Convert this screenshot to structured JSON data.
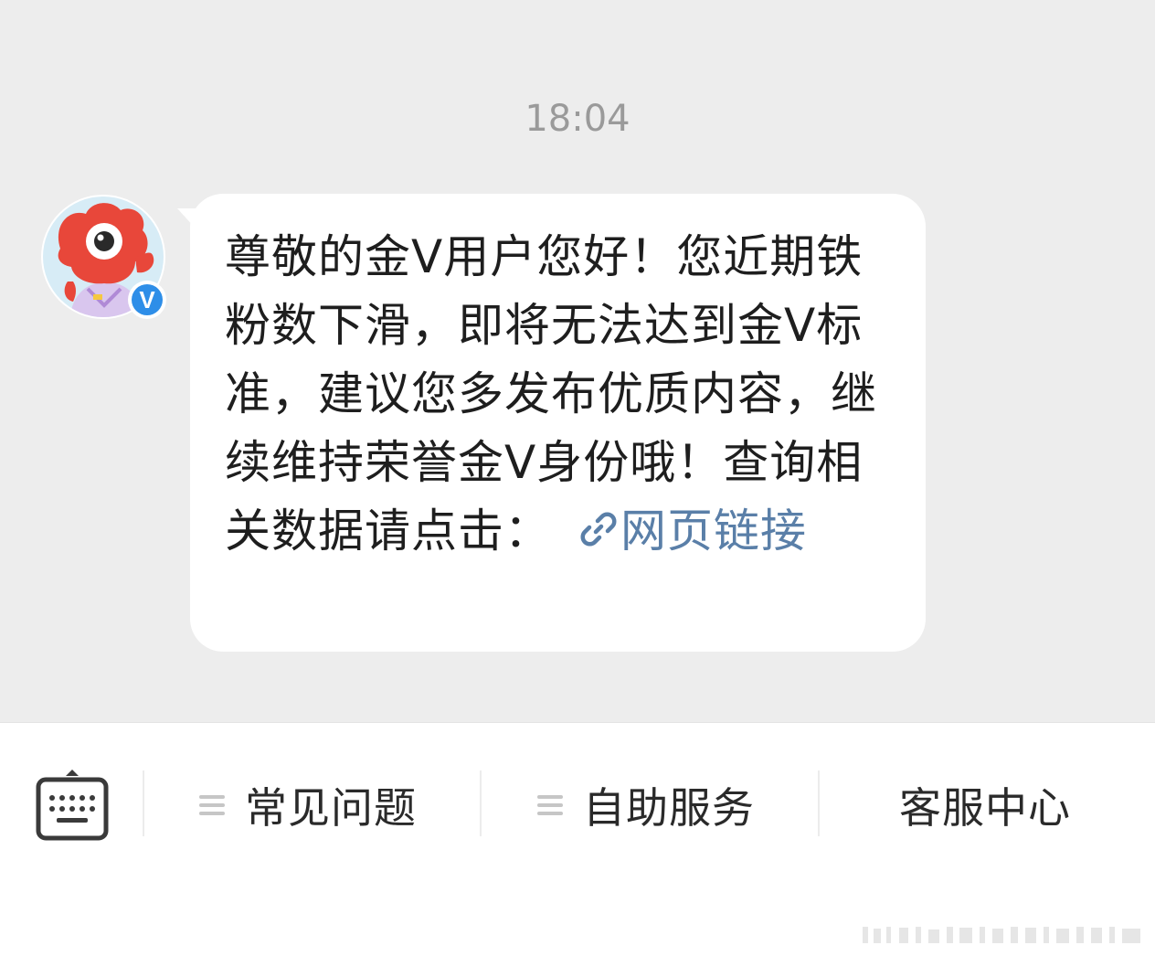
{
  "chat": {
    "timestamp": "18:04",
    "message": {
      "text": "尊敬的金V用户您好！您近期铁粉数下滑，即将无法达到金V标准，建议您多发布优质内容，继续维持荣誉金V身份哦！查询相关数据请点击：",
      "link_label": "网页链接",
      "link_icon": "link-icon"
    },
    "avatar": {
      "badge": "V",
      "badge_color": "#2e8ee8",
      "mascot_color": "#ea4a3a"
    }
  },
  "bottom_menu": {
    "keyboard_icon": "keyboard-icon",
    "items": [
      {
        "label": "常见问题",
        "icon": "menu-lines-icon"
      },
      {
        "label": "自助服务",
        "icon": "menu-lines-icon"
      },
      {
        "label": "客服中心"
      }
    ]
  },
  "colors": {
    "chat_background": "#ededed",
    "link": "#5a7fa8"
  }
}
